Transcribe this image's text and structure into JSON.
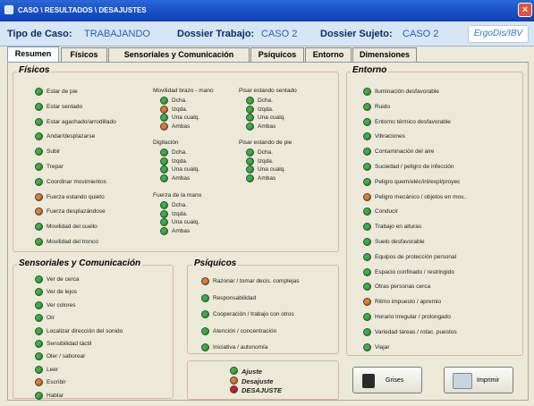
{
  "window": {
    "title": "CASO \\ RESULTADOS \\ DESAJUSTES",
    "close_glyph": "×"
  },
  "casebar": {
    "tipo_label": "Tipo de Caso:",
    "tipo_value": "TRABAJANDO",
    "dtrabajo_label": "Dossier Trabajo:",
    "dtrabajo_value": "CASO 2",
    "dsujeto_label": "Dossier Sujeto:",
    "dsujeto_value": "CASO 2",
    "logo": "ErgoDis/IBV"
  },
  "tabs": [
    "Resumen",
    "Físicos",
    "Sensoriales y Comunicación",
    "Psíquicos",
    "Entorno",
    "Dimensiones"
  ],
  "colors": {
    "green": "#2fb83a",
    "orange": "#e07e2a",
    "red": "#d21d1d"
  },
  "fisicos": {
    "title": "Físicos",
    "items": [
      {
        "label": "Estar de pie",
        "s": "green"
      },
      {
        "label": "Estar sentado",
        "s": "green"
      },
      {
        "label": "Estar agachado/arrodillado",
        "s": "green"
      },
      {
        "label": "Andar/desplazarse",
        "s": "green"
      },
      {
        "label": "Subir",
        "s": "green"
      },
      {
        "label": "Trepar",
        "s": "green"
      },
      {
        "label": "Coordinar movimientos",
        "s": "green"
      },
      {
        "label": "Fuerza estando quieto",
        "s": "orange"
      },
      {
        "label": "Fuerza desplazándose",
        "s": "orange"
      },
      {
        "label": "Movilidad del cuello",
        "s": "green"
      },
      {
        "label": "Movilidad del tronco",
        "s": "green"
      }
    ],
    "groups": [
      {
        "title": "Movilidad brazo - mano",
        "items": [
          {
            "label": "Dcha.",
            "s": "green"
          },
          {
            "label": "Izqda.",
            "s": "orange"
          },
          {
            "label": "Una cualq.",
            "s": "green"
          },
          {
            "label": "Ambas",
            "s": "orange"
          }
        ]
      },
      {
        "title": "Digitación",
        "items": [
          {
            "label": "Dcha.",
            "s": "green"
          },
          {
            "label": "Izqda.",
            "s": "green"
          },
          {
            "label": "Una cualq.",
            "s": "green"
          },
          {
            "label": "Ambas",
            "s": "green"
          }
        ]
      },
      {
        "title": "Fuerza de la mano",
        "items": [
          {
            "label": "Dcha.",
            "s": "green"
          },
          {
            "label": "Izqda.",
            "s": "green"
          },
          {
            "label": "Una cualq.",
            "s": "green"
          },
          {
            "label": "Ambas",
            "s": "green"
          }
        ]
      },
      {
        "title": "Pisar estando sentado",
        "items": [
          {
            "label": "Dcha.",
            "s": "green"
          },
          {
            "label": "Izqda.",
            "s": "green"
          },
          {
            "label": "Una cualq.",
            "s": "green"
          },
          {
            "label": "Ambas",
            "s": "green"
          }
        ]
      },
      {
        "title": "Pisar estando de pie",
        "items": [
          {
            "label": "Dcha.",
            "s": "green"
          },
          {
            "label": "Izqda.",
            "s": "green"
          },
          {
            "label": "Una cualq.",
            "s": "green"
          },
          {
            "label": "Ambas",
            "s": "green"
          }
        ]
      }
    ]
  },
  "entorno": {
    "title": "Entorno",
    "items": [
      {
        "label": "Iluminación desfavorable",
        "s": "green"
      },
      {
        "label": "Ruido",
        "s": "green"
      },
      {
        "label": "Entorno térmico desfavorable",
        "s": "green"
      },
      {
        "label": "Vibraciones",
        "s": "green"
      },
      {
        "label": "Contaminación del aire",
        "s": "green"
      },
      {
        "label": "Suciedad / peligro de infección",
        "s": "green"
      },
      {
        "label": "Peligro quem/eléc/inl/expl/proyec",
        "s": "green"
      },
      {
        "label": "Peligro mecánico / objetos en mov..",
        "s": "orange"
      },
      {
        "label": "Conducir",
        "s": "green"
      },
      {
        "label": "Trabajo en alturas",
        "s": "green"
      },
      {
        "label": "Suelo desfavorable",
        "s": "green"
      },
      {
        "label": "Equipos de protección personal",
        "s": "green"
      },
      {
        "label": "Espacio confinado / restringido",
        "s": "green"
      },
      {
        "label": "Otras personas cerca",
        "s": "green"
      },
      {
        "label": "Ritmo impuesto / apremio",
        "s": "orange"
      },
      {
        "label": "Horario irregular / prolongado",
        "s": "green"
      },
      {
        "label": "Variedad tareas / rotac. puestos",
        "s": "green"
      },
      {
        "label": "Viajar",
        "s": "green"
      }
    ]
  },
  "sensoriales": {
    "title": "Sensoriales y Comunicación",
    "items": [
      {
        "label": "Ver de cerca",
        "s": "green"
      },
      {
        "label": "Ver de lejos",
        "s": "green"
      },
      {
        "label": "Ver colores",
        "s": "green"
      },
      {
        "label": "Oír",
        "s": "green"
      },
      {
        "label": "Localizar dirección del sonido",
        "s": "green"
      },
      {
        "label": "Sensibilidad táctil",
        "s": "green"
      },
      {
        "label": "Oler / saborear",
        "s": "green"
      },
      {
        "label": "Leer",
        "s": "green"
      },
      {
        "label": "Escribir",
        "s": "orange"
      },
      {
        "label": "Hablar",
        "s": "green"
      }
    ]
  },
  "psiquicos": {
    "title": "Psíquicos",
    "items": [
      {
        "label": "Razonar / tomar decis. complejas",
        "s": "orange"
      },
      {
        "label": "Responsabilidad",
        "s": "green"
      },
      {
        "label": "Cooperación / trabajo con otros",
        "s": "green"
      },
      {
        "label": "Atención / concentración",
        "s": "green"
      },
      {
        "label": "Iniciativa / autonomía",
        "s": "green"
      }
    ]
  },
  "legend": [
    {
      "label": "Ajuste",
      "s": "green"
    },
    {
      "label": "Desajuste",
      "s": "orange"
    },
    {
      "label": "DESAJUSTE",
      "s": "red"
    }
  ],
  "buttons": {
    "grises": "Grises",
    "imprimir": "Imprimir"
  }
}
